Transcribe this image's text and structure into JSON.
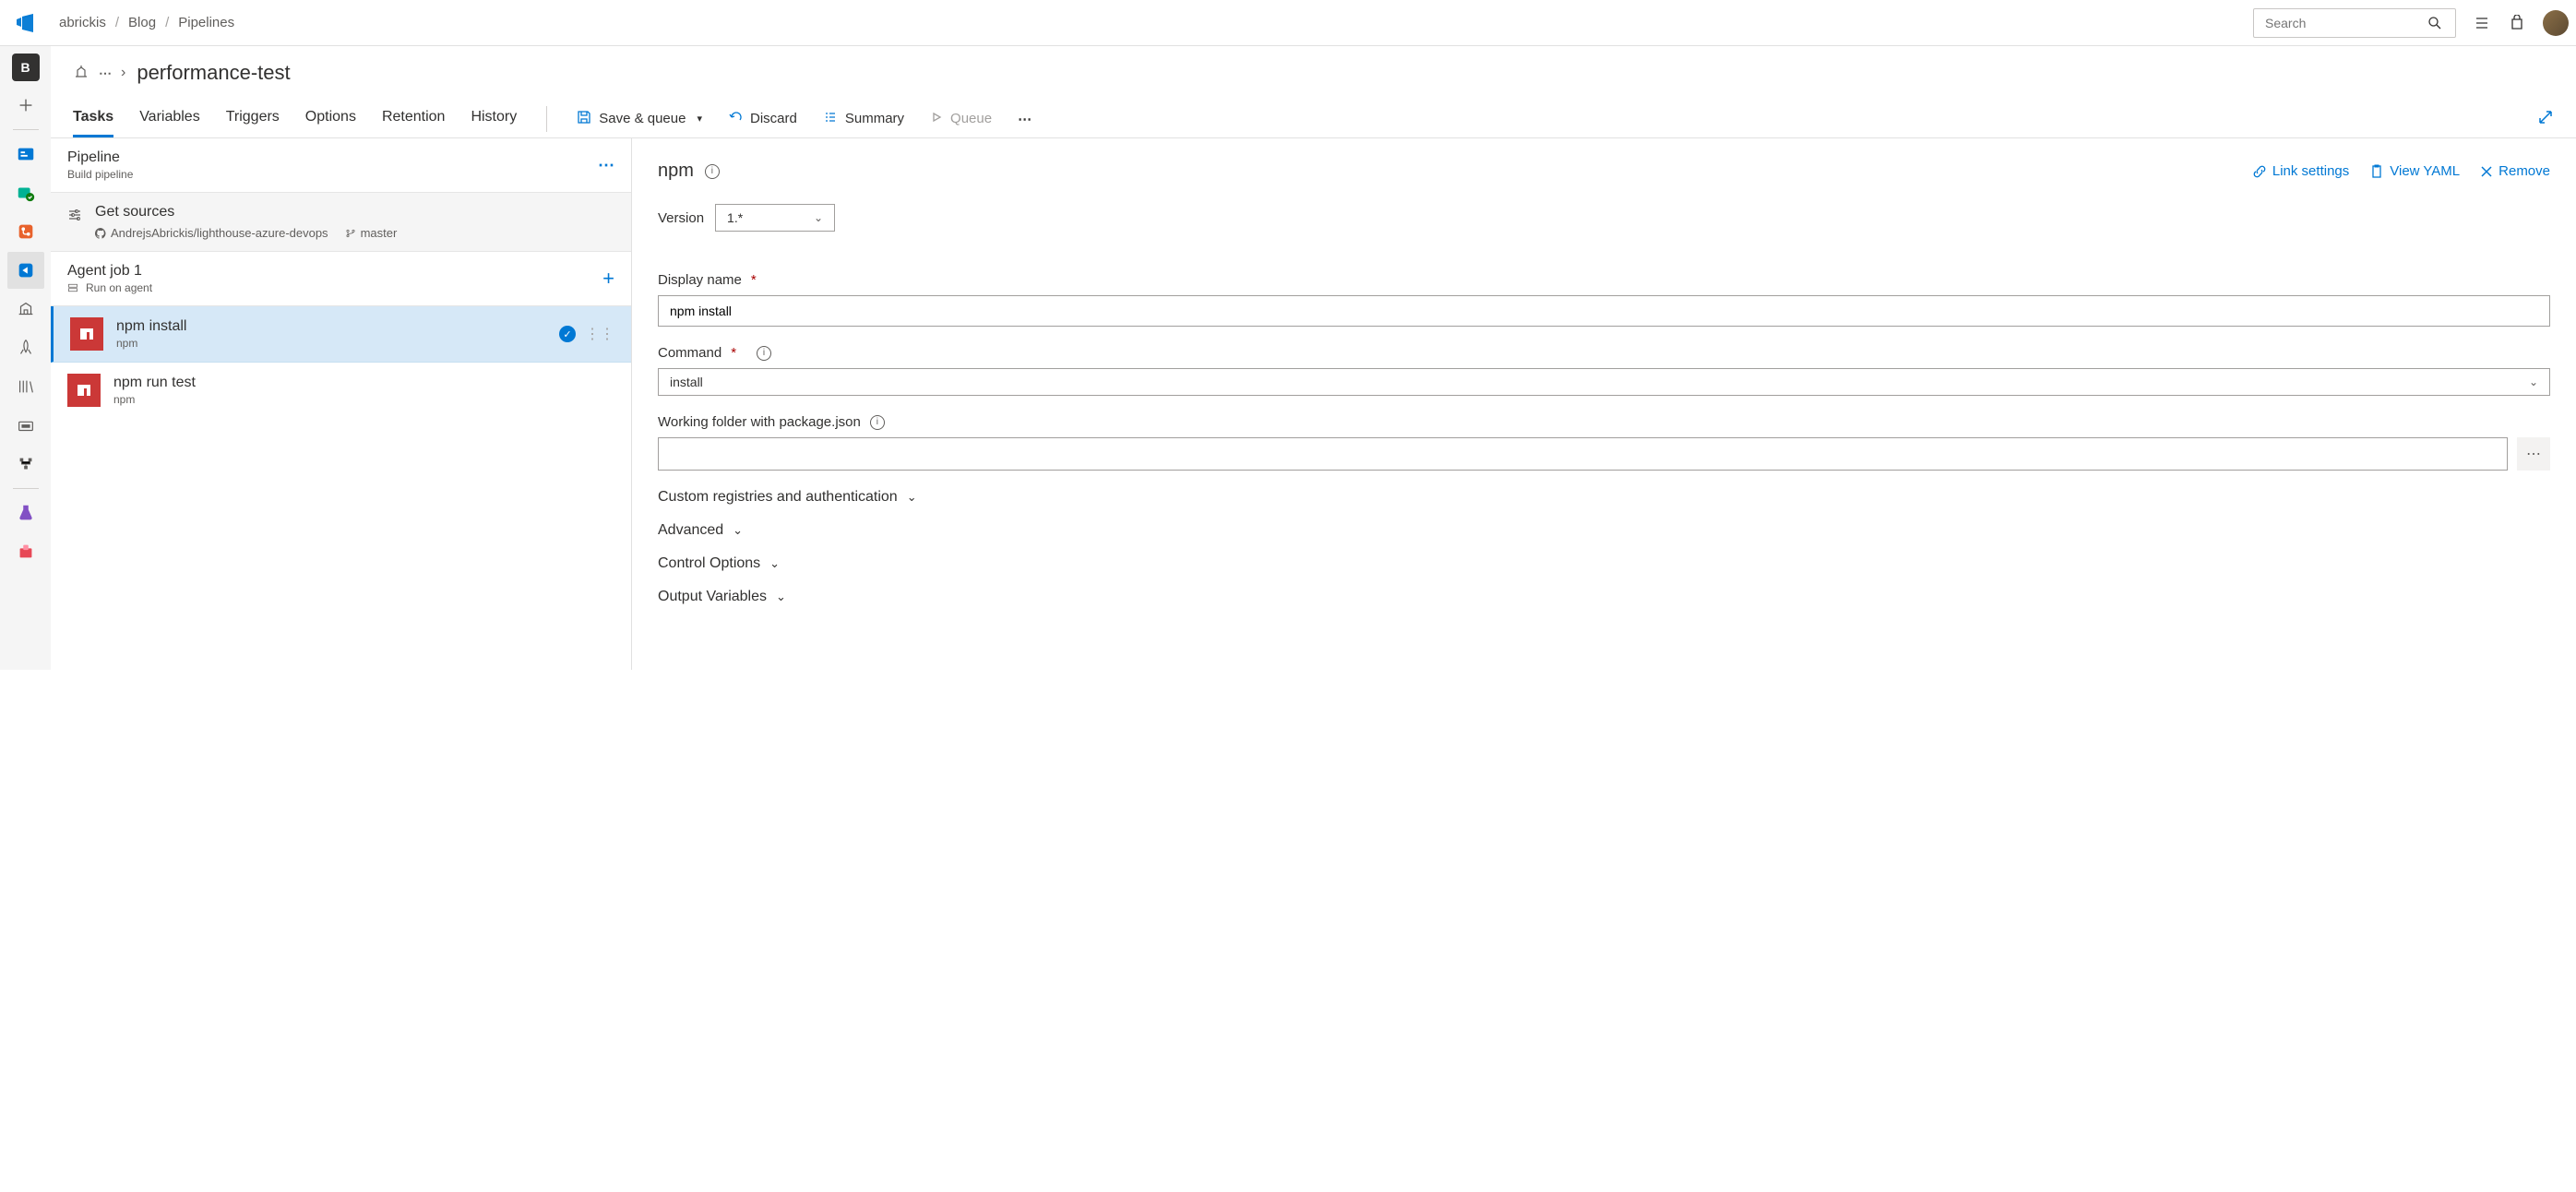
{
  "breadcrumb": {
    "org": "abrickis",
    "project": "Blog",
    "section": "Pipelines"
  },
  "search": {
    "placeholder": "Search"
  },
  "rail": {
    "project_letter": "B"
  },
  "page": {
    "title": "performance-test"
  },
  "tabs": {
    "tasks": "Tasks",
    "variables": "Variables",
    "triggers": "Triggers",
    "options": "Options",
    "retention": "Retention",
    "history": "History"
  },
  "toolbar": {
    "save_queue": "Save & queue",
    "discard": "Discard",
    "summary": "Summary",
    "queue": "Queue"
  },
  "pipeline": {
    "title": "Pipeline",
    "subtitle": "Build pipeline",
    "sources": {
      "title": "Get sources",
      "repo": "AndrejsAbrickis/lighthouse-azure-devops",
      "branch": "master"
    },
    "agent_job": {
      "title": "Agent job 1",
      "subtitle": "Run on agent"
    },
    "tasks": [
      {
        "title": "npm install",
        "sub": "npm",
        "selected": true
      },
      {
        "title": "npm run test",
        "sub": "npm",
        "selected": false
      }
    ]
  },
  "rightpanel": {
    "title": "npm",
    "actions": {
      "link": "Link settings",
      "yaml": "View YAML",
      "remove": "Remove"
    },
    "version": {
      "label": "Version",
      "value": "1.*"
    },
    "display_name": {
      "label": "Display name",
      "value": "npm install"
    },
    "command": {
      "label": "Command",
      "value": "install"
    },
    "working_folder": {
      "label": "Working folder with package.json",
      "value": ""
    },
    "sections": {
      "registries": "Custom registries and authentication",
      "advanced": "Advanced",
      "control": "Control Options",
      "output": "Output Variables"
    }
  }
}
